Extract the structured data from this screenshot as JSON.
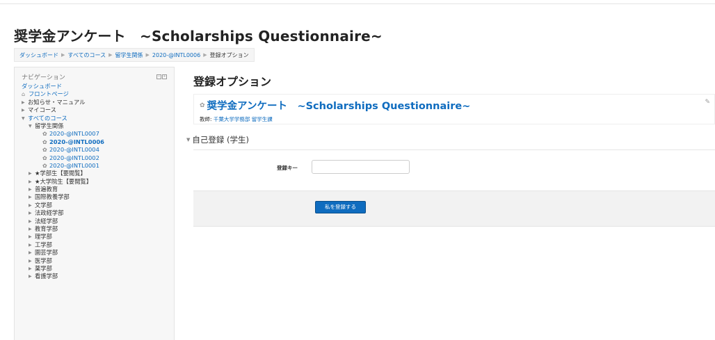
{
  "page": {
    "title": "奨学金アンケート　~Scholarships Questionnaire~"
  },
  "breadcrumb": [
    "ダッシュボード",
    "すべてのコース",
    "留学生関係",
    "2020-@INTL0006",
    "登録オプション"
  ],
  "navigation": {
    "title": "ナビゲーション",
    "dashboard": "ダッシュボード",
    "front_page": "フロントページ",
    "news": "お知らせ・マニュアル",
    "my_courses": "マイコース",
    "all_courses": "すべてのコース",
    "category_intl": "留学生関係",
    "intl_courses": [
      "2020-@INTL0007",
      "2020-@INTL0006",
      "2020-@INTL0004",
      "2020-@INTL0002",
      "2020-@INTL0001"
    ],
    "categories": [
      "★学部生【要閲覧】",
      "★大学院生【要閲覧】",
      "普遍教育",
      "国際教養学部",
      "文学部",
      "法政経学部",
      "法経学部",
      "教育学部",
      "理学部",
      "工学部",
      "園芸学部",
      "医学部",
      "薬学部",
      "看護学部"
    ]
  },
  "main": {
    "heading": "登録オプション",
    "course_title": "奨学金アンケート　~Scholarships Questionnaire~",
    "teacher_label": "教師:",
    "teacher_name": "千葉大学学務部 留学生課",
    "section_title": "自己登録 (学生)",
    "key_label": "登録キー",
    "key_value": "",
    "enrol_button": "私を登録する"
  },
  "colors": {
    "link": "#0f6cbf",
    "button": "#0f6cbf"
  }
}
